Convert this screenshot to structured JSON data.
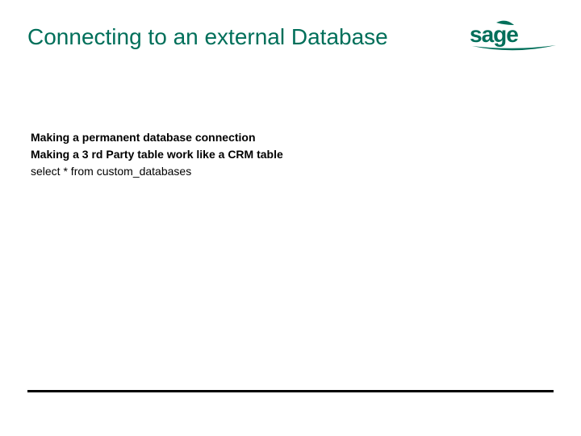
{
  "title": "Connecting to an external Database",
  "logo_text": "sage",
  "body": {
    "line1": "Making a permanent database connection",
    "line2": "Making a 3 rd Party table work like a CRM table",
    "line3": "select * from custom_databases"
  },
  "colors": {
    "accent": "#006f5a"
  }
}
